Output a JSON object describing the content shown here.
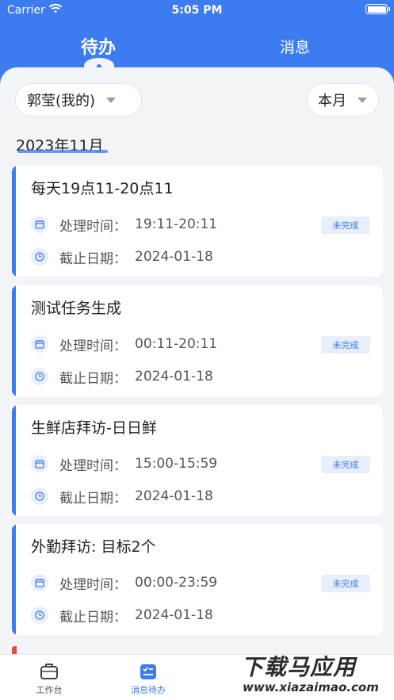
{
  "status_bar": {
    "carrier": "Carrier",
    "time": "5:05 PM"
  },
  "tabs": {
    "todo": "待办",
    "messages": "消息"
  },
  "filters": {
    "owner": "郭莹(我的)",
    "period": "本月"
  },
  "month_heading": "2023年11月",
  "tasks": [
    {
      "title": "每天19点11-20点11",
      "process_label": "处理时间：",
      "process_time": "19:11-20:11",
      "deadline_label": "截止日期：",
      "deadline": "2024-01-18",
      "status": "未完成"
    },
    {
      "title": "测试任务生成",
      "process_label": "处理时间：",
      "process_time": "00:11-20:11",
      "deadline_label": "截止日期：",
      "deadline": "2024-01-18",
      "status": "未完成"
    },
    {
      "title": "生鲜店拜访-日日鲜",
      "process_label": "处理时间：",
      "process_time": "15:00-15:59",
      "deadline_label": "截止日期：",
      "deadline": "2024-01-18",
      "status": "未完成"
    },
    {
      "title": "外勤拜访: 目标2个",
      "process_label": "处理时间：",
      "process_time": "00:00-23:59",
      "deadline_label": "截止日期：",
      "deadline": "2024-01-18",
      "status": "未完成"
    }
  ],
  "tabbar": {
    "work": "工作台",
    "todo": "消息待办"
  },
  "watermark": {
    "title": "下载马应用",
    "url": "www.xiazaimao.com"
  },
  "colors": {
    "accent": "#3d7cf0",
    "background": "#f3f4f7"
  }
}
